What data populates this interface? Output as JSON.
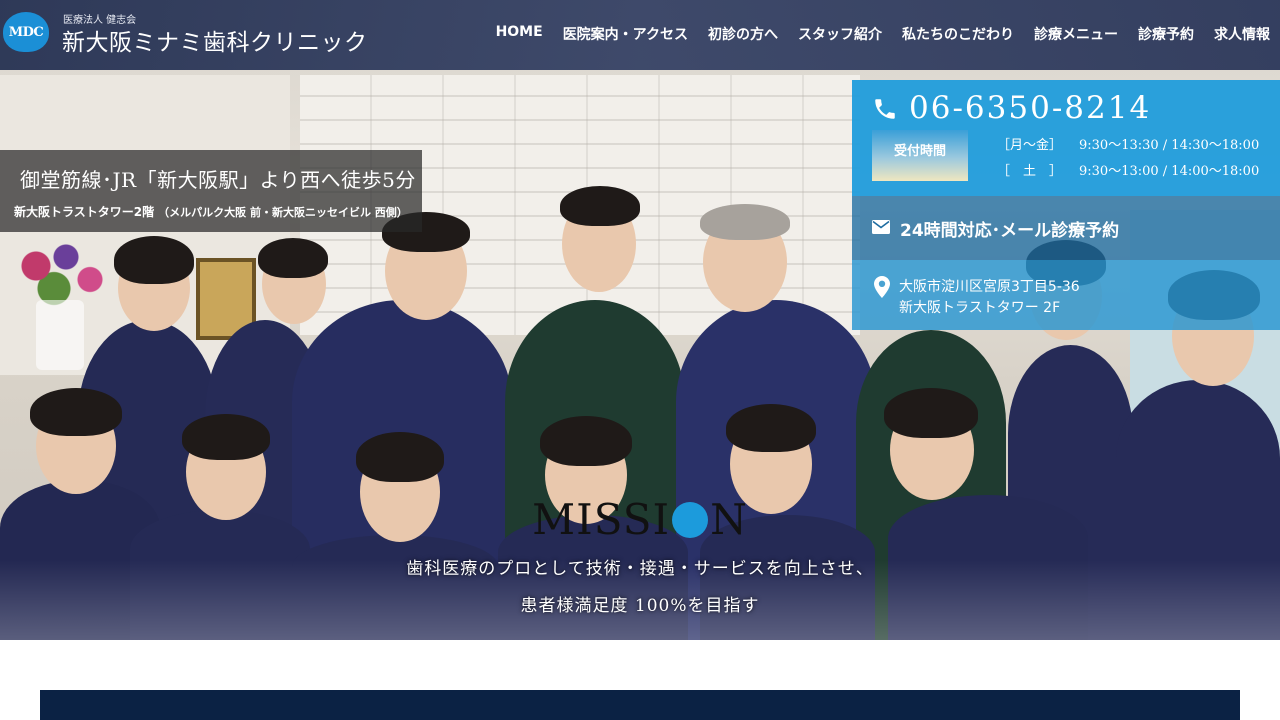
{
  "header": {
    "logo_mark": "MDC",
    "corp_label": "医療法人 健志会",
    "clinic_name": "新大阪ミナミ歯科クリニック",
    "nav": [
      {
        "label": "HOME"
      },
      {
        "label": "医院案内・アクセス"
      },
      {
        "label": "初診の方へ"
      },
      {
        "label": "スタッフ紹介"
      },
      {
        "label": "私たちのこだわり"
      },
      {
        "label": "診療メニュー"
      },
      {
        "label": "診療予約"
      },
      {
        "label": "求人情報"
      }
    ]
  },
  "access": {
    "main": "御堂筋線･JR「新大阪駅」より西へ徒歩5分",
    "sub": "新大阪トラストタワー2階",
    "sub_note": "（メルパルク大阪 前・新大阪ニッセイビル 西側）"
  },
  "contact": {
    "phone_icon": "phone-icon",
    "phone": "06-6350-8214",
    "hours_label": "受付時間",
    "hours": [
      {
        "days": "［月～金］",
        "time": "9:30～13:30 / 14:30～18:00"
      },
      {
        "days": "［　土　］",
        "time": "9:30～13:00 / 14:00～18:00"
      }
    ],
    "mail_icon": "envelope-icon",
    "mail_label": "24時間対応･メール診療予約",
    "pin_icon": "map-pin-icon",
    "address_line1": "大阪市淀川区宮原3丁目5-36",
    "address_line2": "新大阪トラストタワー 2F"
  },
  "mission": {
    "title_left": "MISSI",
    "title_right": "N",
    "line1": "歯科医療のプロとして技術・接遇・サービスを向上させ、",
    "line2": "患者様満足度 100%を目指す"
  },
  "colors": {
    "header_bg": "#2a3860",
    "accent_blue": "#1c9bdc",
    "navy": "#0b2244"
  }
}
